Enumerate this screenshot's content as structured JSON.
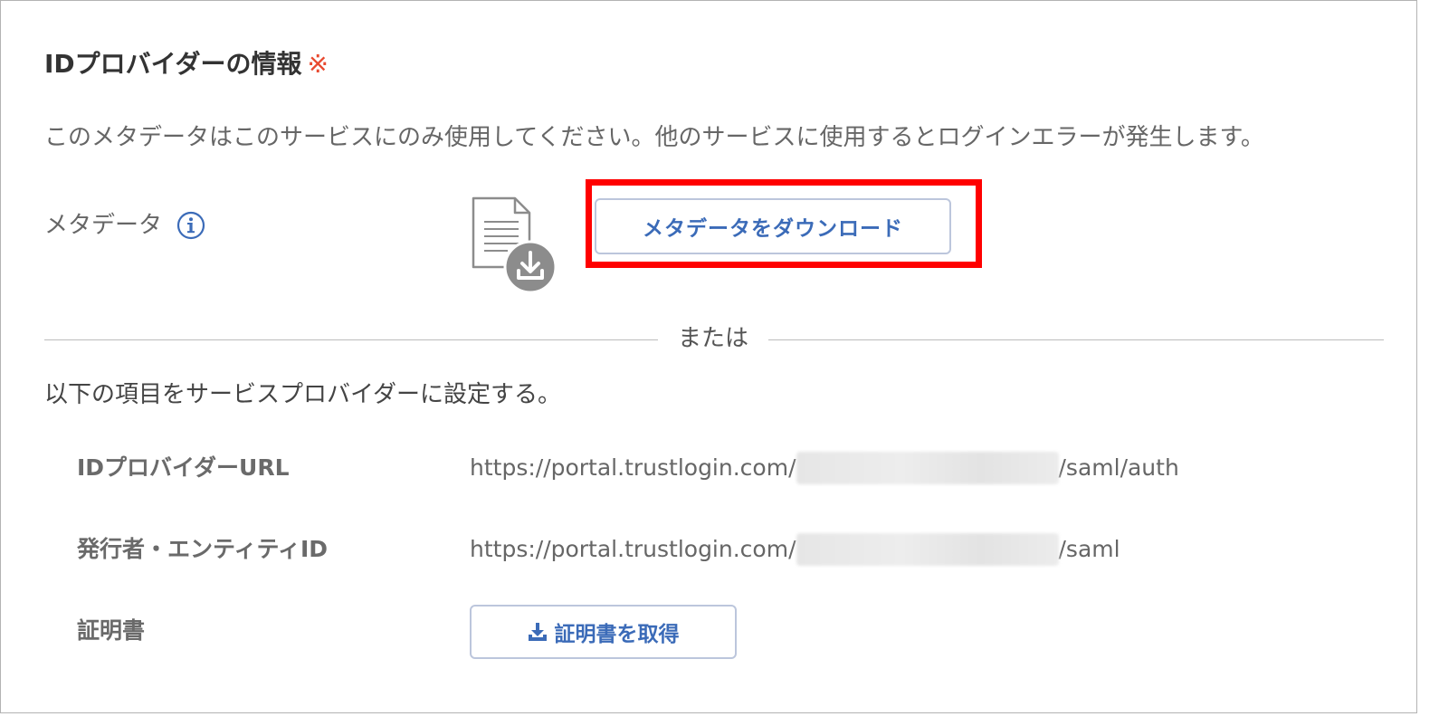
{
  "section": {
    "title": "IDプロバイダーの情報",
    "required_mark": "※",
    "description": "このメタデータはこのサービスにのみ使用してください。他のサービスに使用するとログインエラーが発生します。"
  },
  "metadata": {
    "label": "メタデータ",
    "download_button_label": "メタデータをダウンロード"
  },
  "divider": {
    "text": "または"
  },
  "manual": {
    "instruction": "以下の項目をサービスプロバイダーに設定する。",
    "fields": [
      {
        "label": "IDプロバイダーURL",
        "value_prefix": "https://portal.trustlogin.com/",
        "value_suffix": "/saml/auth"
      },
      {
        "label": "発行者・エンティティID",
        "value_prefix": "https://portal.trustlogin.com/",
        "value_suffix": "/saml"
      },
      {
        "label": "証明書",
        "button_label": "証明書を取得"
      }
    ]
  },
  "colors": {
    "accent_blue": "#3b6bb8",
    "required_red": "#e8492f",
    "highlight_red": "#ff0000",
    "icon_gray": "#8c8c8c"
  },
  "icons": {
    "info": "info-circle-icon",
    "metadata": "document-download-icon",
    "cert_button": "download-tray-icon"
  }
}
